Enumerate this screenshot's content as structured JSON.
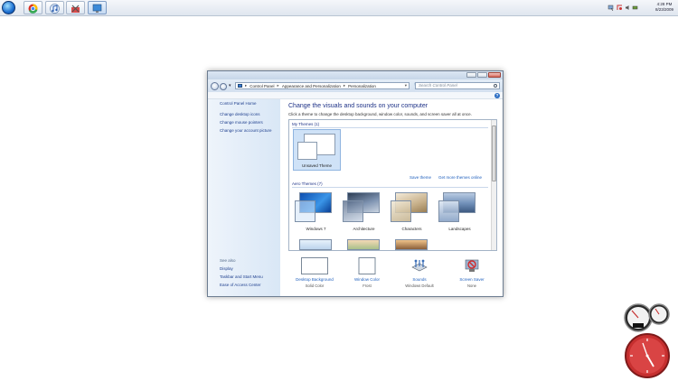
{
  "taskbar": {
    "pinned": [
      "ie-icon",
      "chrome-icon",
      "itunes-icon",
      "tools-icon",
      "personalization-icon"
    ],
    "clock": {
      "time": "4:28 PM",
      "date": "8/23/2009"
    }
  },
  "window": {
    "address": {
      "crumbs": [
        "Control Panel",
        "Appearance and Personalization",
        "Personalization"
      ]
    },
    "search_placeholder": "Search Control Panel",
    "help": "?",
    "left_pane": {
      "links": [
        "Control Panel Home",
        "Change desktop icons",
        "Change mouse pointers",
        "Change your account picture"
      ],
      "see_also_label": "See also",
      "see_also": [
        "Display",
        "Taskbar and Start Menu",
        "Ease of Access Center"
      ]
    },
    "main": {
      "heading": "Change the visuals and sounds on your computer",
      "subtitle": "Click a theme to change the desktop background, window color, sounds, and screen saver all at once.",
      "my_themes_label": "My Themes (1)",
      "my_themes": [
        {
          "name": "Unsaved Theme"
        }
      ],
      "save_theme": "Save theme",
      "get_more": "Get more themes online",
      "aero_label": "Aero Themes (7)",
      "aero_themes": [
        {
          "name": "Windows 7",
          "color": "#1f6fcf"
        },
        {
          "name": "Architecture",
          "color": "#5b6e88"
        },
        {
          "name": "Characters",
          "color": "#c7b08a"
        },
        {
          "name": "Landscapes",
          "color": "#6f8fb8"
        }
      ]
    },
    "bottom": [
      {
        "label": "Desktop Background",
        "sub": "Solid Color",
        "icon": "desktop-background-icon"
      },
      {
        "label": "Window Color",
        "sub": "Frost",
        "icon": "window-color-icon"
      },
      {
        "label": "Sounds",
        "sub": "Windows Default",
        "icon": "sounds-icon"
      },
      {
        "label": "Screen Saver",
        "sub": "None",
        "icon": "screen-saver-icon"
      }
    ]
  },
  "colors": {
    "accent": "#1e5fbd",
    "heading": "#1e3287",
    "clock_gadget": "#c62f2f"
  }
}
